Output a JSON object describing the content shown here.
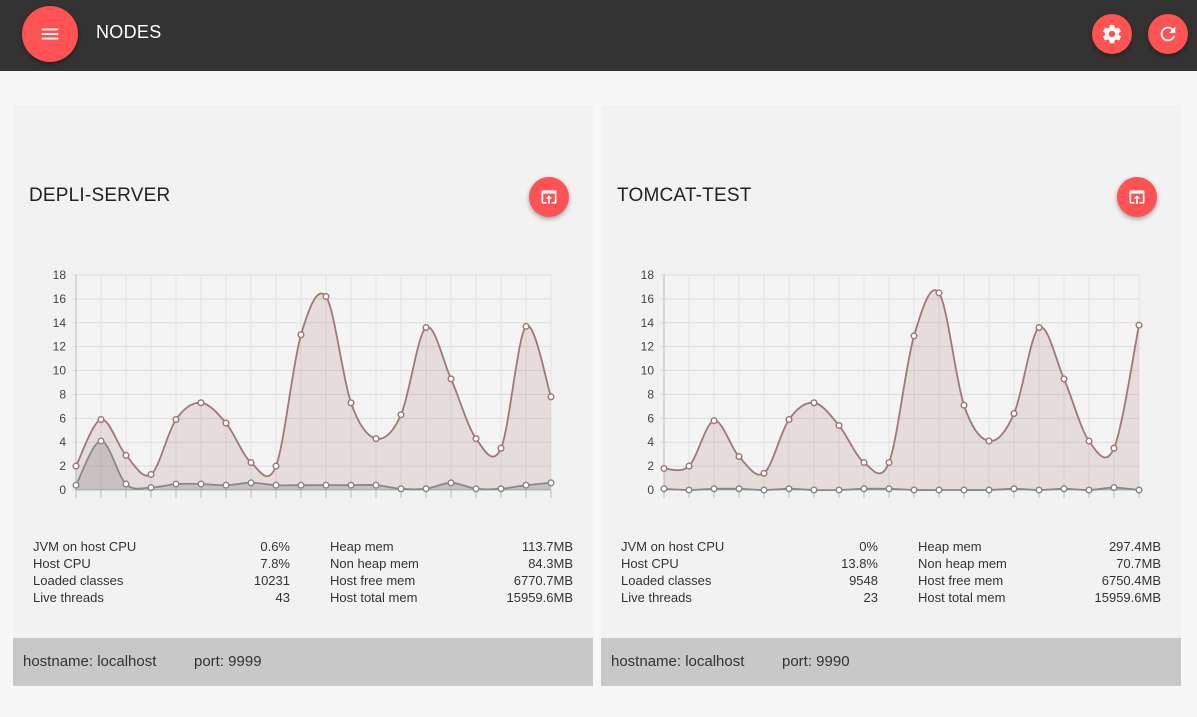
{
  "app": {
    "title": "NODES",
    "menu_icon": "hamburger-menu-icon",
    "settings_icon": "gear-icon",
    "refresh_icon": "refresh-icon"
  },
  "colors": {
    "topbar": "#333333",
    "accent": "#ff5252",
    "cpu_line": "#a07878",
    "jvm_line": "#888888",
    "footer": "#c8c8c8"
  },
  "nodes": [
    {
      "name": "DEPLI-SERVER",
      "open_icon": "open-in-new-icon",
      "stats_left": [
        {
          "label": "JVM on host CPU",
          "value": "0.6%"
        },
        {
          "label": "Host CPU",
          "value": "7.8%"
        },
        {
          "label": "Loaded classes",
          "value": "10231"
        },
        {
          "label": "Live threads",
          "value": "43"
        }
      ],
      "stats_right": [
        {
          "label": "Heap mem",
          "value": "113.7MB"
        },
        {
          "label": "Non heap mem",
          "value": "84.3MB"
        },
        {
          "label": "Host free mem",
          "value": "6770.7MB"
        },
        {
          "label": "Host total mem",
          "value": "15959.6MB"
        }
      ],
      "footer": {
        "hostname": "hostname: localhost",
        "port": "port: 9999"
      },
      "chart_data": {
        "type": "line",
        "ylim": [
          0,
          18
        ],
        "yticks": [
          "0",
          "2",
          "4",
          "6",
          "8",
          "10",
          "12",
          "14",
          "16",
          "18"
        ],
        "series": [
          {
            "values": [
              2.0,
              5.9,
              2.9,
              1.3,
              5.9,
              7.3,
              5.6,
              2.3,
              2.0,
              13.0,
              16.2,
              7.3,
              4.3,
              6.3,
              13.6,
              9.3,
              4.3,
              3.5,
              13.7,
              7.8
            ]
          },
          {
            "values": [
              0.4,
              4.1,
              0.5,
              0.2,
              0.5,
              0.5,
              0.4,
              0.6,
              0.4,
              0.4,
              0.4,
              0.4,
              0.4,
              0.1,
              0.1,
              0.6,
              0.1,
              0.1,
              0.4,
              0.6
            ]
          }
        ]
      }
    },
    {
      "name": "TOMCAT-TEST",
      "open_icon": "open-in-new-icon",
      "stats_left": [
        {
          "label": "JVM on host CPU",
          "value": "0%"
        },
        {
          "label": "Host CPU",
          "value": "13.8%"
        },
        {
          "label": "Loaded classes",
          "value": "9548"
        },
        {
          "label": "Live threads",
          "value": "23"
        }
      ],
      "stats_right": [
        {
          "label": "Heap mem",
          "value": "297.4MB"
        },
        {
          "label": "Non heap mem",
          "value": "70.7MB"
        },
        {
          "label": "Host free mem",
          "value": "6750.4MB"
        },
        {
          "label": "Host total mem",
          "value": "15959.6MB"
        }
      ],
      "footer": {
        "hostname": "hostname: localhost",
        "port": "port: 9990"
      },
      "chart_data": {
        "type": "line",
        "ylim": [
          0,
          18
        ],
        "yticks": [
          "0",
          "2",
          "4",
          "6",
          "8",
          "10",
          "12",
          "14",
          "16",
          "18"
        ],
        "series": [
          {
            "values": [
              1.8,
              2.0,
              5.8,
              2.8,
              1.4,
              5.9,
              7.3,
              5.4,
              2.3,
              2.3,
              12.9,
              16.5,
              7.1,
              4.1,
              6.4,
              13.6,
              9.3,
              4.1,
              3.5,
              13.8
            ]
          },
          {
            "values": [
              0.1,
              0.0,
              0.1,
              0.1,
              0.0,
              0.1,
              0.0,
              0.0,
              0.1,
              0.1,
              0.0,
              0.0,
              0.0,
              0.0,
              0.1,
              0.0,
              0.1,
              0.0,
              0.2,
              0.0
            ]
          }
        ]
      }
    }
  ]
}
